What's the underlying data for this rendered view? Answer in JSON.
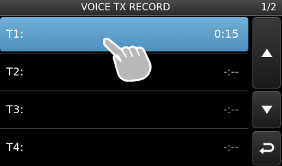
{
  "header": {
    "title": "VOICE TX RECORD",
    "page_indicator": "1/2"
  },
  "records": [
    {
      "label": "T1:",
      "value": "0:15",
      "selected": true
    },
    {
      "label": "T2:",
      "value": "-:--",
      "selected": false
    },
    {
      "label": "T3:",
      "value": "-:--",
      "selected": false
    },
    {
      "label": "T4:",
      "value": "-:--",
      "selected": false
    }
  ],
  "icons": {
    "scroll_up": "triangle-up-icon",
    "scroll_down": "triangle-down-icon",
    "back": "return-arrow-icon",
    "pointer": "pointing-hand-icon"
  },
  "colors": {
    "selected_row": "#5fa0cc",
    "background": "#000000",
    "empty_value": "#9a9a9a"
  }
}
